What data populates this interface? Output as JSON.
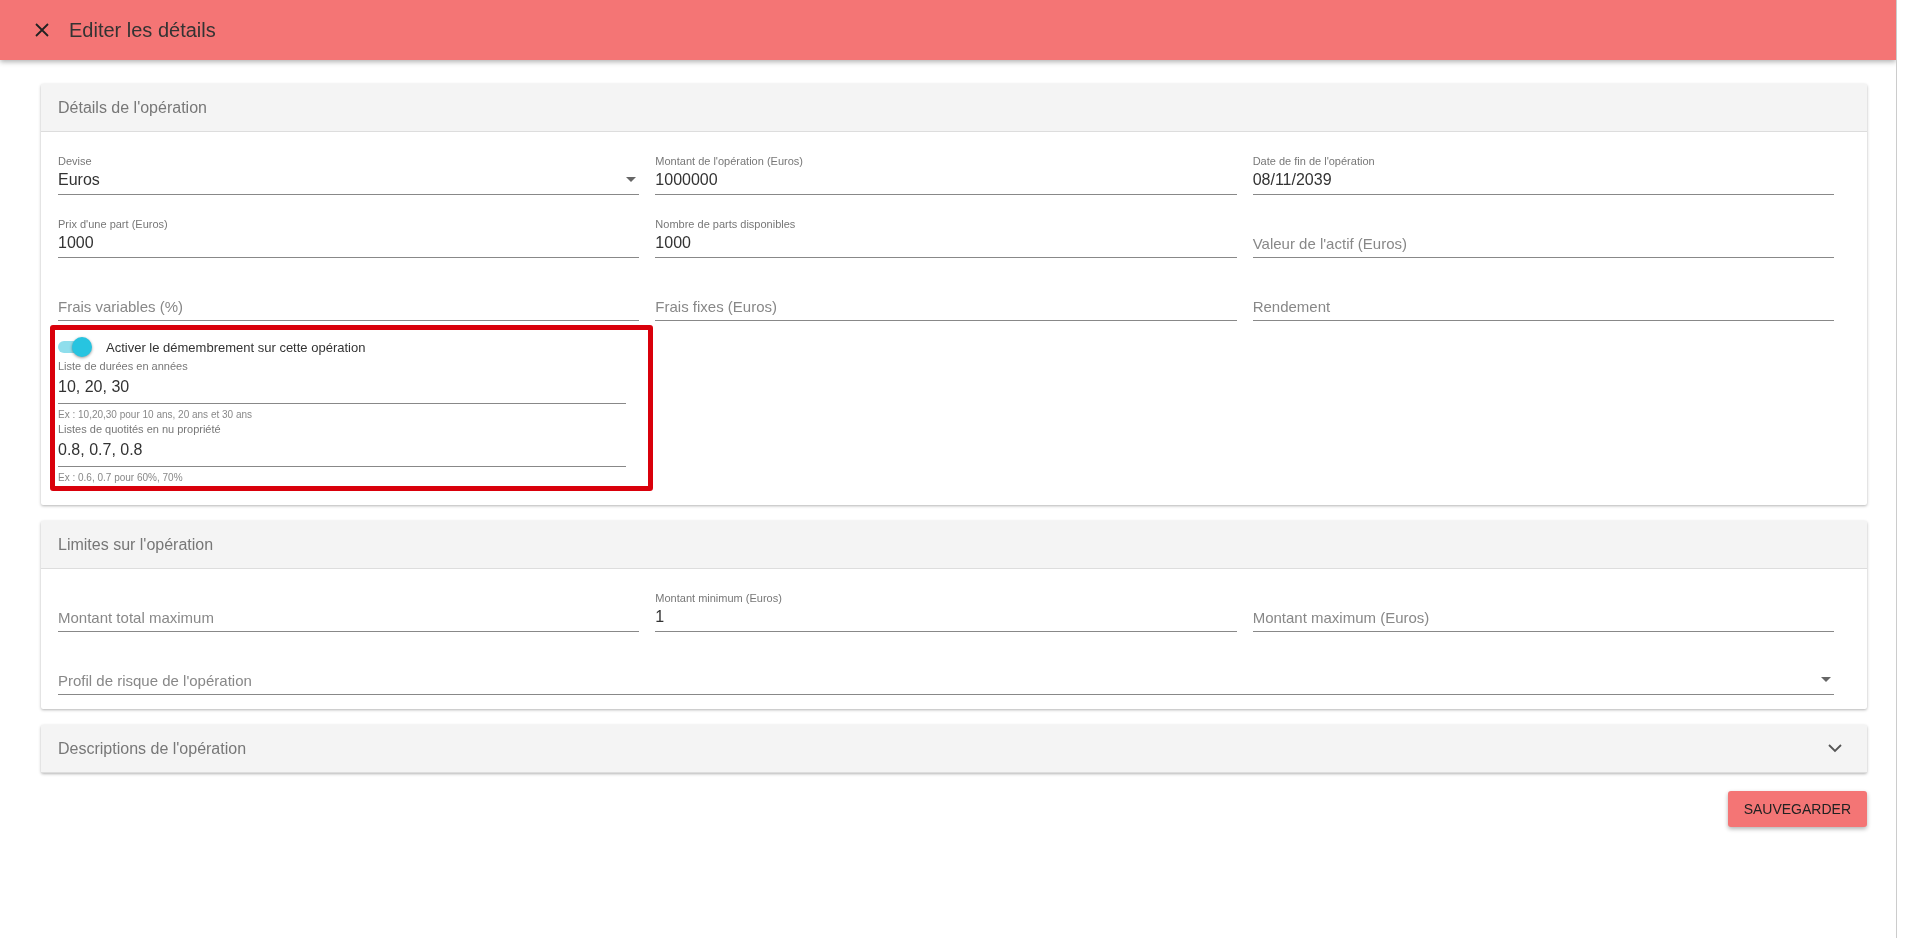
{
  "header": {
    "title": "Editer les détails"
  },
  "sections": [
    {
      "title": "Détails de l'opération",
      "expanded": true,
      "fields": [
        {
          "kind": "select",
          "label": "Devise",
          "value": "Euros"
        },
        {
          "kind": "text",
          "label": "Montant de l'opération (Euros)",
          "value": "1000000"
        },
        {
          "kind": "text",
          "label": "Date de fin de l'opération",
          "value": "08/11/2039"
        },
        {
          "kind": "text",
          "label": "Prix d'une part (Euros)",
          "value": "1000"
        },
        {
          "kind": "text",
          "label": "Nombre de parts disponibles",
          "value": "1000"
        },
        {
          "kind": "text",
          "label": "Valeur de l'actif (Euros)"
        },
        {
          "kind": "text",
          "label": "Frais variables (%)"
        },
        {
          "kind": "text",
          "label": "Frais fixes (Euros)"
        },
        {
          "kind": "text",
          "label": "Rendement"
        }
      ],
      "dismemberment": {
        "toggle": {
          "label": "Activer le démembrement sur cette opération",
          "on": true
        },
        "fields": [
          {
            "label": "Liste de durées en années",
            "value": "10, 20, 30",
            "hint": "Ex : 10,20,30 pour 10 ans, 20 ans et 30 ans"
          },
          {
            "label": "Listes de quotités en nu propriété",
            "value": "0.8, 0.7, 0.8",
            "hint": "Ex : 0.6, 0.7 pour 60%, 70%"
          }
        ]
      }
    },
    {
      "title": "Limites sur l'opération",
      "expanded": true,
      "fields": [
        {
          "kind": "text",
          "label": "Montant total maximum"
        },
        {
          "kind": "text",
          "label": "Montant minimum (Euros)",
          "value": "1"
        },
        {
          "kind": "text",
          "label": "Montant maximum (Euros)"
        },
        {
          "kind": "select",
          "wide": true,
          "label": "Profil de risque de l'opération"
        }
      ]
    },
    {
      "title": "Descriptions de l'opération",
      "expanded": false
    }
  ],
  "save_button": "SAUVEGARDER"
}
